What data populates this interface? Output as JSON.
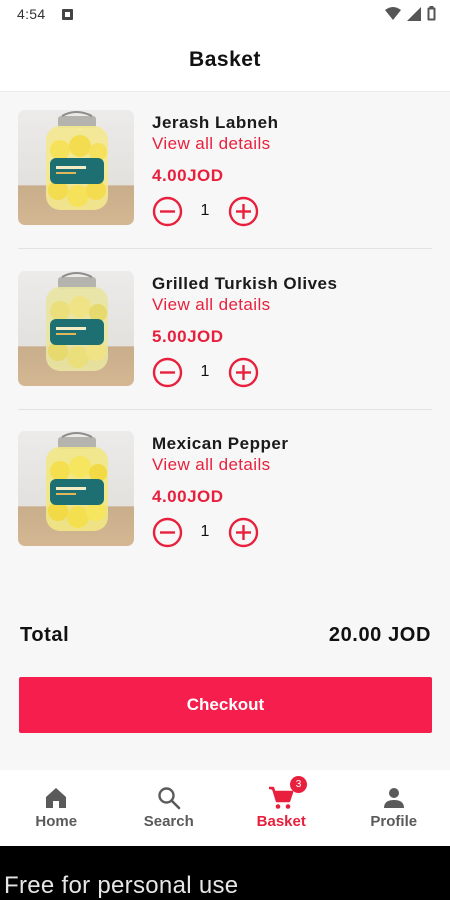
{
  "status_bar": {
    "time": "4:54"
  },
  "header": {
    "title": "Basket"
  },
  "items": [
    {
      "name": "Jerash Labneh",
      "details_label": "View all details",
      "price": "4.00JOD",
      "quantity": "1"
    },
    {
      "name": "Grilled Turkish Olives",
      "details_label": "View all details",
      "price": "5.00JOD",
      "quantity": "1"
    },
    {
      "name": "Mexican Pepper",
      "details_label": "View all details",
      "price": "4.00JOD",
      "quantity": "1"
    }
  ],
  "summary": {
    "total_label": "Total",
    "total_value": "20.00 JOD"
  },
  "checkout": {
    "label": "Checkout"
  },
  "nav": {
    "items": [
      {
        "label": "Home",
        "icon": "home-icon"
      },
      {
        "label": "Search",
        "icon": "search-icon"
      },
      {
        "label": "Basket",
        "icon": "cart-icon",
        "active": true
      },
      {
        "label": "Profile",
        "icon": "person-icon"
      }
    ],
    "basket_badge": "3"
  },
  "watermark": {
    "text": "Free for personal use"
  },
  "colors": {
    "accent": "#e8203d",
    "checkout": "#f61e4c",
    "background": "#f7f7f7",
    "watermark_bg": "#000000"
  }
}
